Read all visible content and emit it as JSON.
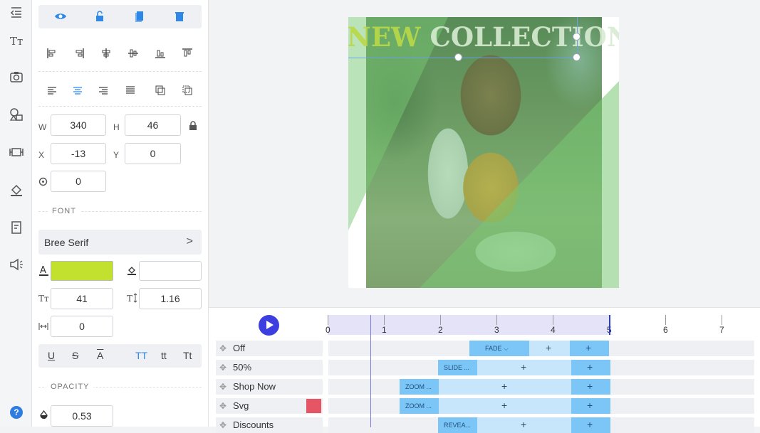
{
  "rail": {
    "icons": [
      "collapse-icon",
      "text-icon",
      "camera-icon",
      "shapes-icon",
      "video-icon",
      "fill-icon",
      "template-icon",
      "audio-icon",
      "help-icon"
    ],
    "help_label": "?"
  },
  "panel": {
    "toolbar_icons": [
      "eye-icon",
      "lock-icon",
      "duplicate-icon",
      "trash-icon"
    ],
    "width_label": "W",
    "width_value": "340",
    "height_label": "H",
    "height_value": "46",
    "x_label": "X",
    "x_value": "-13",
    "y_label": "Y",
    "y_value": "0",
    "rotation_value": "0",
    "font_section": "FONT",
    "font_name": "Bree Serif",
    "font_chevron": ">",
    "text_color": "#c2e02e",
    "font_size": "41",
    "line_height": "1.16",
    "letter_spacing": "0",
    "case_buttons": [
      "U",
      "S",
      "A",
      "TT",
      "tt",
      "Tt"
    ],
    "opacity_section": "OPACITY",
    "opacity_value": "0.53"
  },
  "canvas": {
    "headline_word1": "NEW",
    "headline_word2": "COLLECTION"
  },
  "timeline": {
    "ticks": [
      "0",
      "1",
      "2",
      "3",
      "4",
      "5",
      "6",
      "7"
    ],
    "layers": [
      {
        "name": "Off",
        "anim": "FADE ⌵"
      },
      {
        "name": "50%",
        "anim": "SLIDE ..."
      },
      {
        "name": "Shop Now",
        "anim": "ZOOM ..."
      },
      {
        "name": "Svg",
        "anim": "ZOOM ..."
      },
      {
        "name": "Discounts",
        "anim": "REVEA..."
      }
    ],
    "svg_swatch_color": "#e65563"
  }
}
